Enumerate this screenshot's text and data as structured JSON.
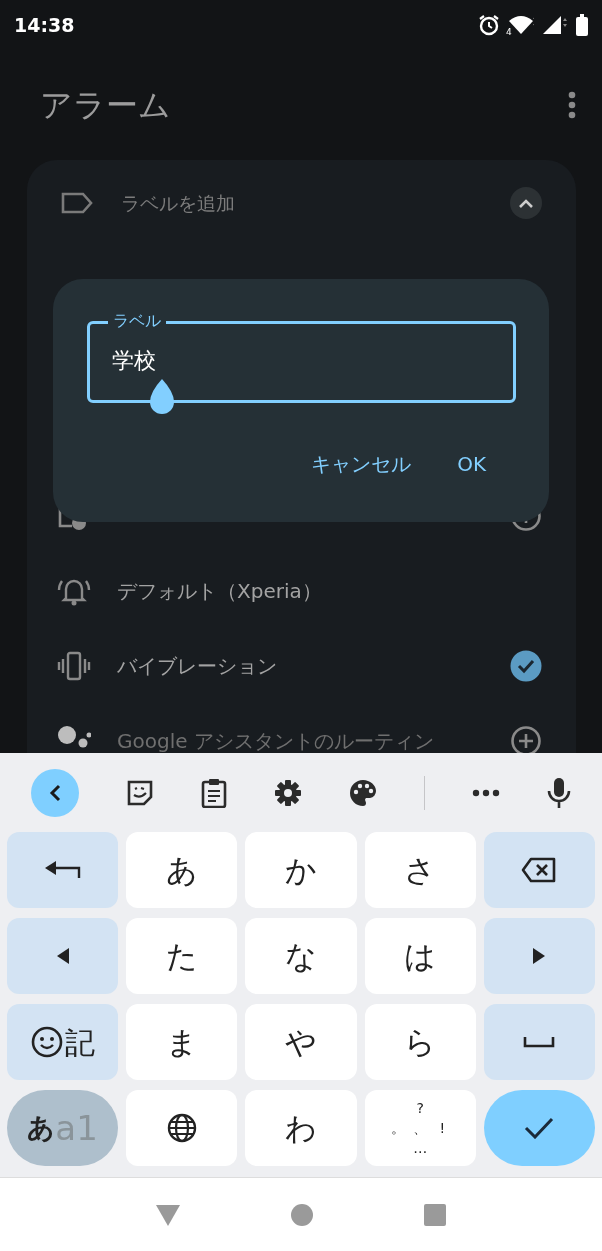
{
  "status_bar": {
    "time": "14:38",
    "wifi_badge": "4"
  },
  "app_bar": {
    "title": "アラーム"
  },
  "alarm": {
    "label_placeholder": "ラベルを追加",
    "expanded": true,
    "options": [
      {
        "kind": "ringtone",
        "text": "デフォルト（Xperia）"
      },
      {
        "kind": "vibrate",
        "text": "バイブレーション",
        "checked": true
      },
      {
        "kind": "assistant",
        "text": "Google アシスタントのルーティン"
      }
    ]
  },
  "dialog": {
    "field_label": "ラベル",
    "value": "学校",
    "buttons": [
      "キャンセル",
      "OK"
    ]
  },
  "keyboard": {
    "keys": [
      {
        "kind": "return"
      },
      {
        "kind": "char",
        "label": "あ"
      },
      {
        "kind": "char",
        "label": "か"
      },
      {
        "kind": "char",
        "label": "さ"
      },
      {
        "kind": "backspace"
      },
      {
        "kind": "left"
      },
      {
        "kind": "char",
        "label": "た"
      },
      {
        "kind": "char",
        "label": "な"
      },
      {
        "kind": "char",
        "label": "は"
      },
      {
        "kind": "right"
      },
      {
        "kind": "emoji",
        "label": "記"
      },
      {
        "kind": "char",
        "label": "ま"
      },
      {
        "kind": "char",
        "label": "や"
      },
      {
        "kind": "char",
        "label": "ら"
      },
      {
        "kind": "space"
      },
      {
        "kind": "mode",
        "label": "あ",
        "sub": "a1"
      },
      {
        "kind": "globe"
      },
      {
        "kind": "char",
        "label": "わ"
      },
      {
        "kind": "punctuation",
        "marks": [
          "?",
          "。",
          "、",
          "!",
          "…"
        ]
      },
      {
        "kind": "enter"
      }
    ]
  }
}
